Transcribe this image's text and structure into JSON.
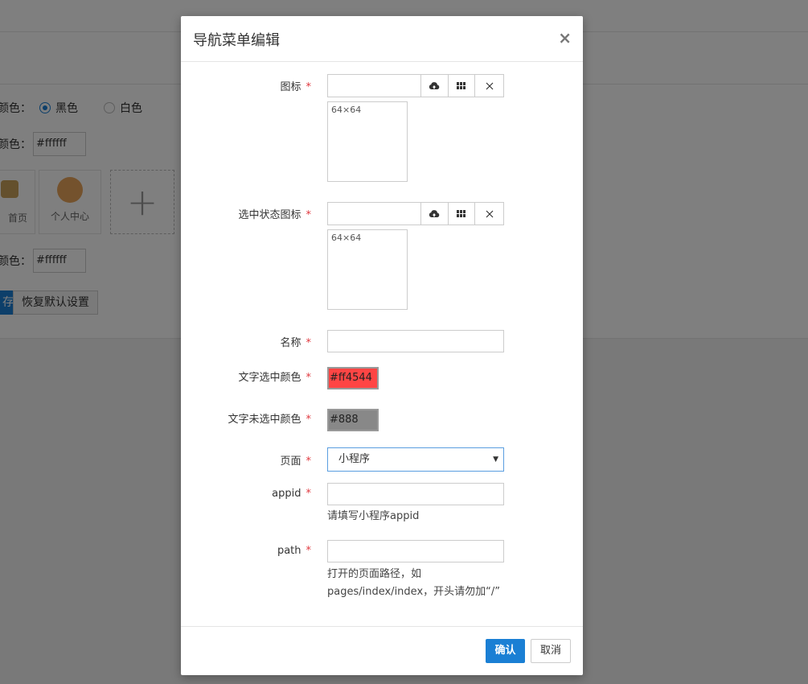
{
  "background": {
    "color_row1_label": "颜色：",
    "radio_black": "黑色",
    "radio_white": "白色",
    "color_row2_label": "颜色：",
    "color_row2_value": "#ffffff",
    "nav_item1_label": "首页",
    "nav_item2_label": "个人中心",
    "add_symbol": "+",
    "color_row3_label": "颜色：",
    "color_row3_value": "#ffffff",
    "save_button": "存",
    "reset_button": "恢复默认设置"
  },
  "modal": {
    "title": "导航菜单编辑",
    "close": "×",
    "fields": {
      "icon": {
        "label": "图标",
        "preview_size": "64×64"
      },
      "active_icon": {
        "label": "选中状态图标",
        "preview_size": "64×64"
      },
      "name": {
        "label": "名称",
        "value": ""
      },
      "active_text_color": {
        "label": "文字选中颜色",
        "value": "#ff4544"
      },
      "inactive_text_color": {
        "label": "文字未选中颜色",
        "value": "#888"
      },
      "page": {
        "label": "页面",
        "selected": "小程序"
      },
      "appid": {
        "label": "appid",
        "value": "",
        "help": "请填写小程序appid"
      },
      "path": {
        "label": "path",
        "value": "",
        "help_line1": "打开的页面路径，如",
        "help_line2": "pages/index/index，开头请勿加“/”"
      }
    },
    "required_mark": "*",
    "icons": {
      "upload": "cloud-upload-icon",
      "grid": "grid-icon",
      "clear": "close-icon"
    },
    "confirm_button": "确认",
    "cancel_button": "取消"
  },
  "colors": {
    "primary": "#1a7fd4",
    "required": "#e0383e",
    "active_swatch": "#ff4544",
    "inactive_swatch": "#888888"
  }
}
